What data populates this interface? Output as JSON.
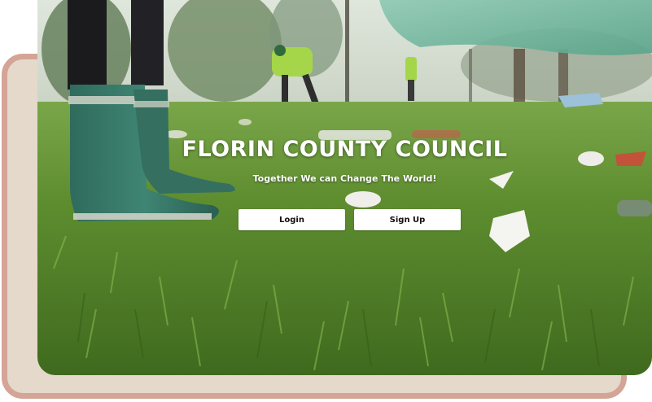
{
  "hero": {
    "title": "FLORIN COUNTY COUNCIL",
    "tagline": "Together We can Change The World!",
    "buttons": {
      "login": "Login",
      "signup": "Sign Up"
    }
  },
  "colors": {
    "back_card_fill": "#e4d9ca",
    "back_card_border": "#d4a496",
    "grass": "#5a8a2e",
    "button_bg": "#ffffff",
    "title_text": "#ffffff"
  }
}
